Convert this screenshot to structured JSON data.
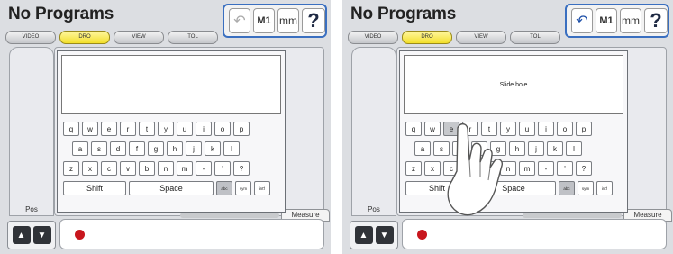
{
  "panels": [
    {
      "title": "No Programs",
      "tabs": [
        {
          "label": "VIDEO",
          "active": false
        },
        {
          "label": "DRO",
          "active": true
        },
        {
          "label": "VIEW",
          "active": false
        },
        {
          "label": "TOL",
          "active": false
        }
      ],
      "toolbar": {
        "undo_icon": "undo-icon",
        "m1_label": "M1",
        "unit_label": "mm",
        "help_label": "?"
      },
      "side_label": "Pos",
      "measure_tab": "Measure",
      "entry_text": "",
      "keyboard": {
        "row1": [
          "q",
          "w",
          "e",
          "r",
          "t",
          "y",
          "u",
          "i",
          "o",
          "p"
        ],
        "row2": [
          "a",
          "s",
          "d",
          "f",
          "g",
          "h",
          "j",
          "k",
          "l"
        ],
        "row3": [
          "z",
          "x",
          "c",
          "v",
          "b",
          "n",
          "m",
          "-",
          "'",
          "?"
        ],
        "shift": "Shift",
        "space": "Space",
        "modes": [
          "abc",
          "sym",
          "int'l"
        ]
      }
    },
    {
      "title": "No Programs",
      "tabs": [
        {
          "label": "VIDEO",
          "active": false
        },
        {
          "label": "DRO",
          "active": true
        },
        {
          "label": "VIEW",
          "active": false
        },
        {
          "label": "TOL",
          "active": false
        }
      ],
      "toolbar": {
        "undo_icon": "undo-icon",
        "m1_label": "M1",
        "unit_label": "mm",
        "help_label": "?"
      },
      "side_label": "Pos",
      "measure_tab": "Measure",
      "entry_text": "Slide hole",
      "pressed_key": "e",
      "keyboard": {
        "row1": [
          "q",
          "w",
          "e",
          "r",
          "t",
          "y",
          "u",
          "i",
          "o",
          "p"
        ],
        "row2": [
          "a",
          "s",
          "d",
          "f",
          "g",
          "h",
          "j",
          "k",
          "l"
        ],
        "row3": [
          "z",
          "x",
          "c",
          "v",
          "b",
          "n",
          "m",
          "-",
          "'",
          "?"
        ],
        "shift": "Shift",
        "space": "Space",
        "modes": [
          "abc",
          "sym",
          "int'l"
        ]
      }
    }
  ],
  "colors": {
    "accent_blue": "#3a6fc0",
    "active_tab_yellow": "#f3df2a",
    "record_red": "#c8161d"
  }
}
